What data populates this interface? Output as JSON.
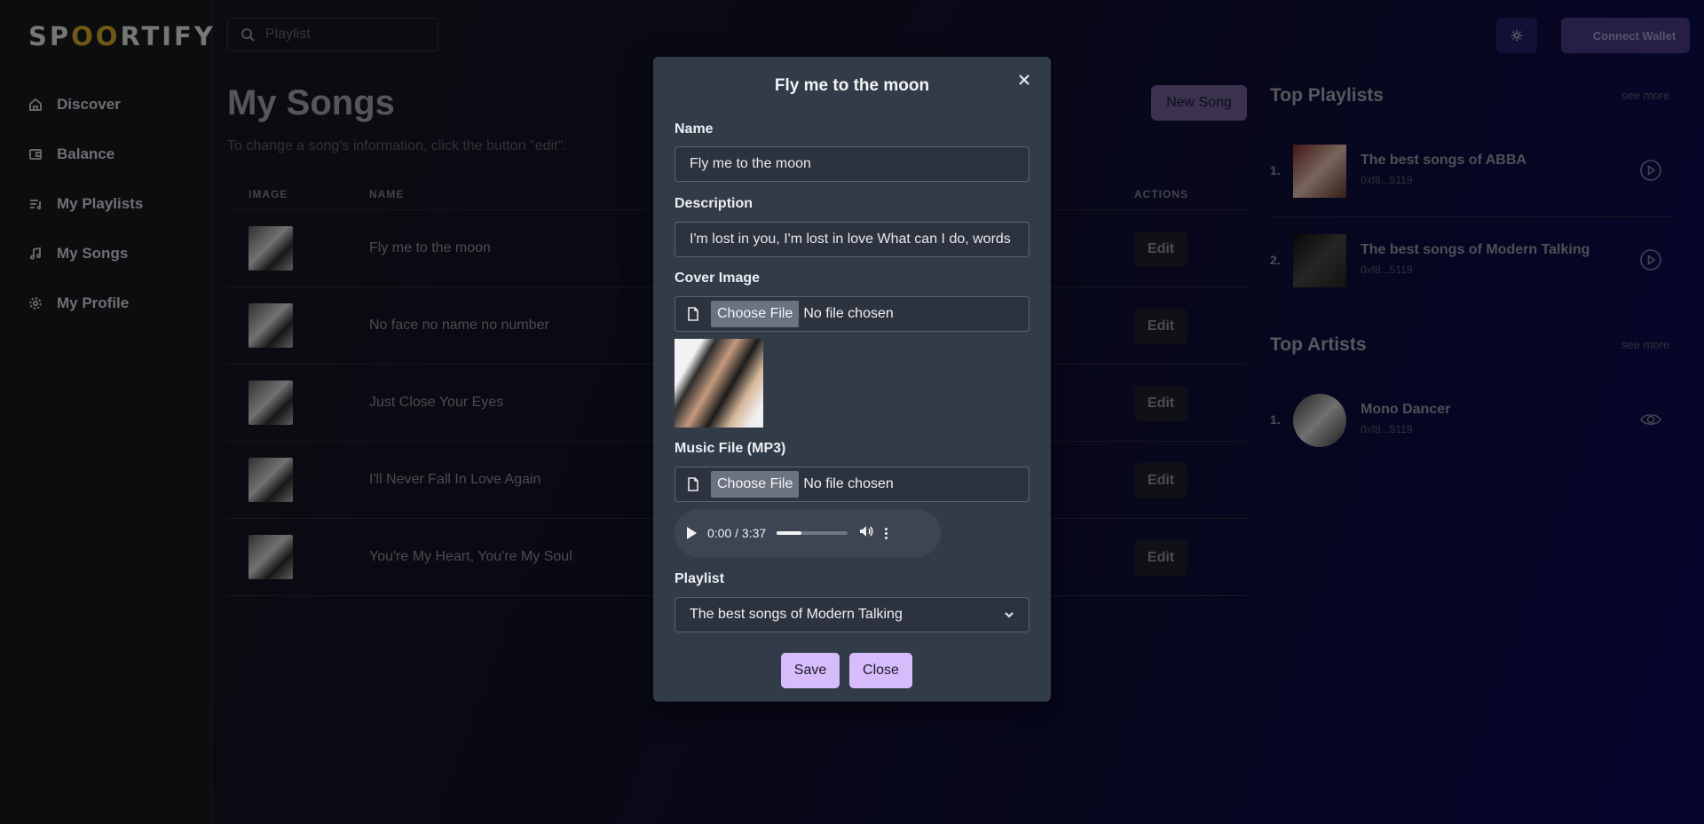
{
  "app": {
    "logo_text": "SPOORTIFY",
    "colors": {
      "accent": "#d6bcfa",
      "logo_accent": "#c9a227",
      "modal_bg": "#323b48"
    }
  },
  "sidebar": {
    "items": [
      {
        "label": "Discover",
        "icon": "home-icon"
      },
      {
        "label": "Balance",
        "icon": "wallet-icon"
      },
      {
        "label": "My Playlists",
        "icon": "playlist-icon"
      },
      {
        "label": "My Songs",
        "icon": "music-note-icon"
      },
      {
        "label": "My Profile",
        "icon": "gear-icon"
      }
    ]
  },
  "header": {
    "search_placeholder": "Playlist",
    "theme_icon": "sun-icon",
    "connect_wallet": "Connect Wallet"
  },
  "main": {
    "title": "My Songs",
    "subtitle": "To change a song's information, click the button \"edit\".",
    "new_song": "New Song",
    "columns": {
      "image": "IMAGE",
      "name": "NAME",
      "actions": "ACTIONS"
    },
    "rows": [
      {
        "name": "Fly me to the moon",
        "action": "Edit"
      },
      {
        "name": "No face no name no number",
        "action": "Edit"
      },
      {
        "name": "Just Close Your Eyes",
        "action": "Edit"
      },
      {
        "name": "I'll Never Fall In Love Again",
        "action": "Edit"
      },
      {
        "name": "You're My Heart, You're My Soul",
        "action": "Edit"
      }
    ]
  },
  "right_panel": {
    "top_playlists": {
      "title": "Top Playlists",
      "see_more": "see more",
      "items": [
        {
          "rank": "1.",
          "name": "The best songs of ABBA",
          "address": "0xf8...5119",
          "icon": "play-circle-icon"
        },
        {
          "rank": "2.",
          "name": "The best songs of Modern Talking",
          "address": "0xf8...5119",
          "icon": "play-circle-icon"
        }
      ]
    },
    "top_artists": {
      "title": "Top Artists",
      "see_more": "see more",
      "items": [
        {
          "rank": "1.",
          "name": "Mono Dancer",
          "address": "0xf8...5119",
          "icon": "eye-icon"
        }
      ]
    }
  },
  "modal": {
    "title": "Fly me to the moon",
    "name_label": "Name",
    "name_value": "Fly me to the moon",
    "description_label": "Description",
    "description_value": "I'm lost in you, I'm lost in love What can I do, words",
    "cover_label": "Cover Image",
    "choose_file": "Choose File",
    "no_file": "No file chosen",
    "music_label": "Music File (MP3)",
    "audio_time": "0:00 / 3:37",
    "audio_progress": 0.35,
    "playlist_label": "Playlist",
    "playlist_value": "The best songs of Modern Talking",
    "save": "Save",
    "close": "Close"
  }
}
